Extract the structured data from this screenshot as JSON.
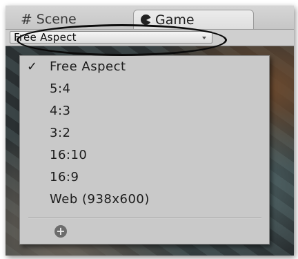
{
  "tabs": [
    {
      "label": "Scene",
      "icon": "hash-icon",
      "active": false
    },
    {
      "label": "Game",
      "icon": "game-controller-icon",
      "active": true
    }
  ],
  "toolbar": {
    "aspect_dropdown": {
      "selected": "Free Aspect",
      "icon": "chevron-down-icon"
    }
  },
  "aspect_menu": {
    "items": [
      {
        "label": "Free Aspect",
        "checked": true
      },
      {
        "label": "5:4",
        "checked": false
      },
      {
        "label": "4:3",
        "checked": false
      },
      {
        "label": "3:2",
        "checked": false
      },
      {
        "label": "16:10",
        "checked": false
      },
      {
        "label": "16:9",
        "checked": false
      },
      {
        "label": "Web (938x600)",
        "checked": false
      }
    ],
    "check_mark": "✓",
    "add_icon": "plus-circle-icon",
    "add_glyph": "+"
  },
  "colors": {
    "menu_background": "#c9c9c9",
    "highlight_ellipse": "#0c0c0c"
  }
}
